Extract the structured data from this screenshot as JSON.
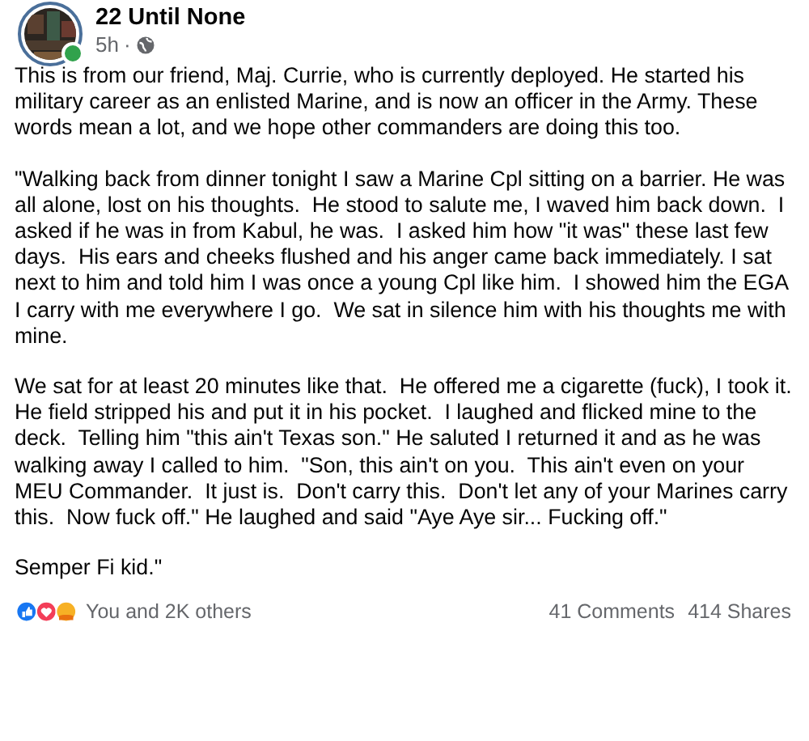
{
  "post": {
    "author": "22 Until None",
    "online": true,
    "time": "5h",
    "separator": "·",
    "paragraphs": [
      "This is from our friend, Maj. Currie, who is currently deployed. He started his military career as an enlisted Marine, and is now an officer in the Army. These words mean a lot, and we hope other commanders are doing this too.",
      "\"Walking back from dinner tonight I saw a Marine Cpl sitting on a barrier. He was all alone, lost on his thoughts.  He stood to salute me, I waved him back down.  I asked if he was in from Kabul, he was.  I asked him how \"it was\" these last few days.  His ears and cheeks flushed and his anger came back immediately. I sat next to him and told him I was once a young Cpl like him.  I showed him the EGA I carry with me everywhere I go.  We sat in silence him with his thoughts me with mine.",
      "We sat for at least 20 minutes like that.  He offered me a cigarette (fuck), I took it.  He field stripped his and put it in his pocket.  I laughed and flicked mine to the deck.  Telling him \"this ain't Texas son.\" He saluted I returned it and as he was walking away I called to him.  \"Son, this ain't on you.  This ain't even on your MEU Commander.  It just is.  Don't carry this.  Don't let any of your Marines carry this.  Now fuck off.\" He laughed and said \"Aye Aye sir... Fucking off.\"",
      "Semper Fi kid.\""
    ]
  },
  "footer": {
    "reactions": "You and 2K others",
    "comments": "41 Comments",
    "shares": "414 Shares"
  }
}
